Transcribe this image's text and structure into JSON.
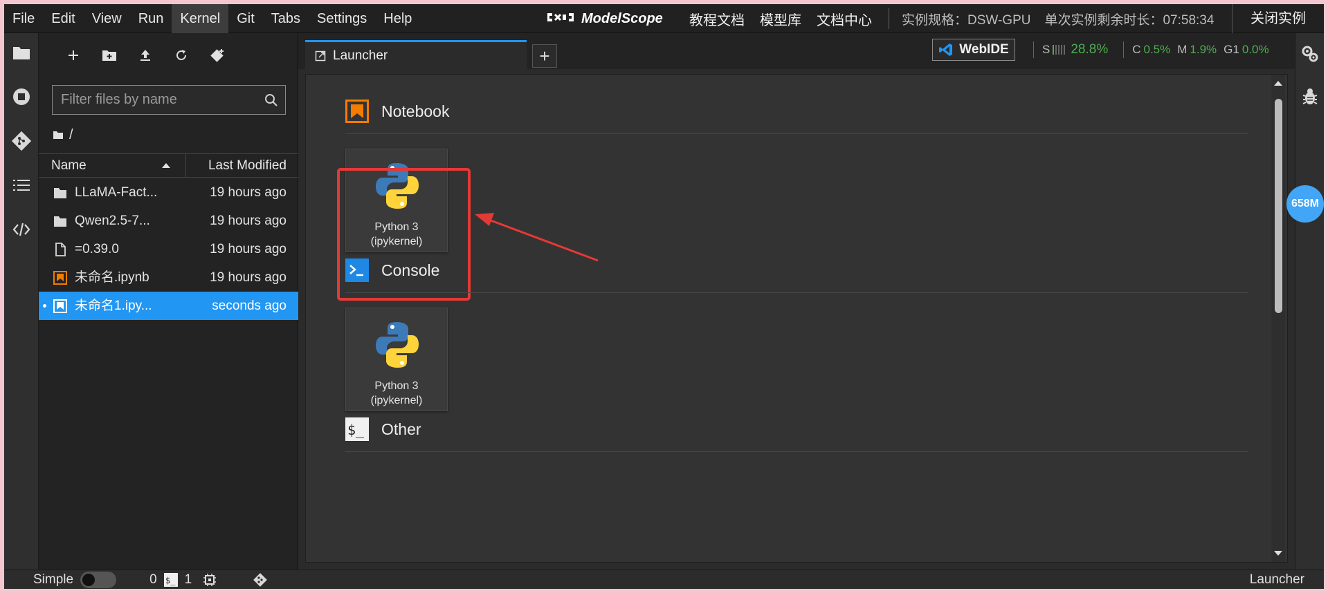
{
  "menu": {
    "items": [
      "File",
      "Edit",
      "View",
      "Run",
      "Kernel",
      "Git",
      "Tabs",
      "Settings",
      "Help"
    ],
    "active_index": 4
  },
  "brand": {
    "text": "ModelScope"
  },
  "top_links": [
    "教程文档",
    "模型库",
    "文档中心"
  ],
  "instance": {
    "spec": "实例规格：DSW-GPU",
    "remaining": "单次实例剩余时长：07:58:34",
    "close_label": "关闭实例"
  },
  "file_browser": {
    "filter_placeholder": "Filter files by name",
    "breadcrumb": "/",
    "header_name": "Name",
    "header_modified": "Last Modified",
    "files": [
      {
        "name": "LLaMA-Fact...",
        "modified": "19 hours ago",
        "type": "folder"
      },
      {
        "name": "Qwen2.5-7...",
        "modified": "19 hours ago",
        "type": "folder"
      },
      {
        "name": "=0.39.0",
        "modified": "19 hours ago",
        "type": "file"
      },
      {
        "name": "未命名.ipynb",
        "modified": "19 hours ago",
        "type": "notebook"
      },
      {
        "name": "未命名1.ipy...",
        "modified": "seconds ago",
        "type": "notebook",
        "selected": true
      }
    ]
  },
  "tabs": {
    "active_label": "Launcher",
    "add_label": "+"
  },
  "webide": {
    "label": "WebIDE"
  },
  "stats": {
    "s_key": "S",
    "s_val": "28.8%",
    "c_key": "C",
    "c_val": "0.5%",
    "m_key": "M",
    "m_val": "1.9%",
    "g_key": "G1",
    "g_val": "0.0%"
  },
  "launcher": {
    "sections": [
      {
        "title": "Notebook",
        "card_line1": "Python 3",
        "card_line2": "(ipykernel)"
      },
      {
        "title": "Console",
        "card_line1": "Python 3",
        "card_line2": "(ipykernel)"
      },
      {
        "title": "Other"
      }
    ]
  },
  "memory_badge": "658M",
  "status": {
    "mode_label": "Simple",
    "kernels": "0",
    "terminals": "1",
    "right_label": "Launcher"
  },
  "colors": {
    "accent": "#2196f3",
    "notebook_orange": "#f57c00",
    "console_blue": "#1e88e5",
    "highlight_red": "#e53935",
    "stat_green": "#4caf50"
  }
}
